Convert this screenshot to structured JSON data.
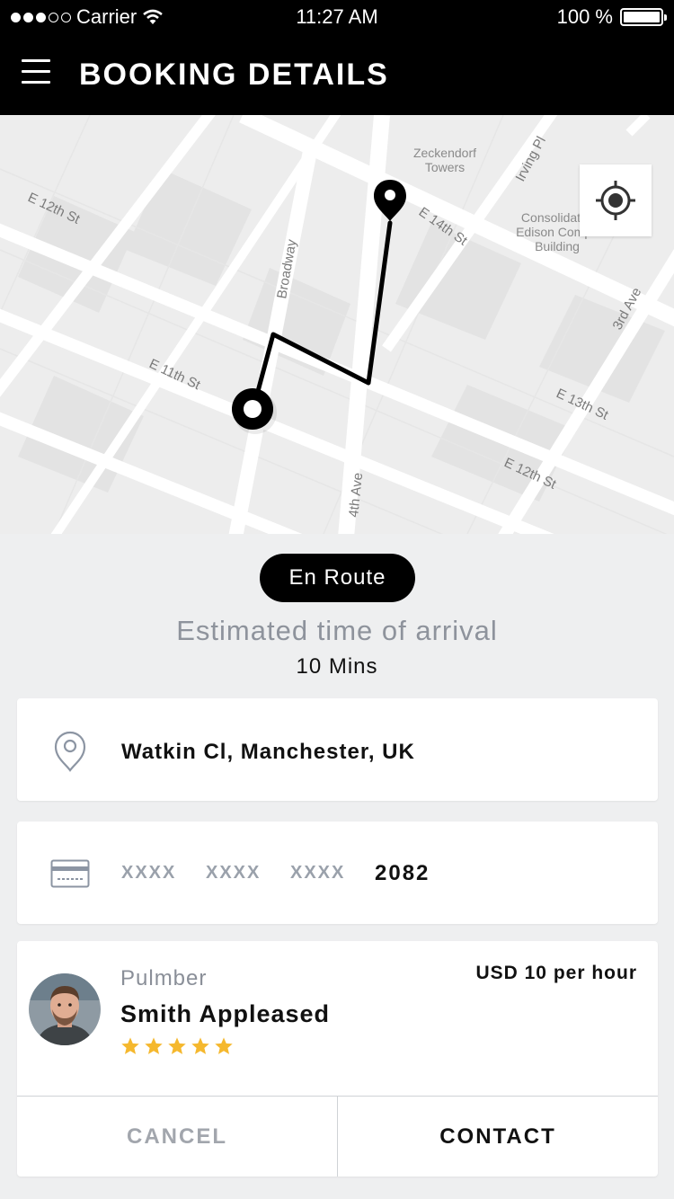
{
  "status_bar": {
    "carrier": "Carrier",
    "time": "11:27 AM",
    "battery": "100 %"
  },
  "header": {
    "title": "BOOKING DETAILS",
    "menu_icon": "hamburger-menu-icon"
  },
  "map": {
    "street_labels": {
      "e12_left": "E 12th St",
      "e14": "E 14th St",
      "irving": "Irving Pl",
      "broadway": "Broadway",
      "e11": "E 11th St",
      "third_ave": "3rd Ave",
      "e13": "E 13th St",
      "fourth_ave": "4th Ave",
      "e12_right": "E 12th St"
    },
    "place_labels": {
      "zeckendorf_1": "Zeckendorf",
      "zeckendorf_2": "Towers",
      "consolidated_1": "Consolidat",
      "consolidated_2": "Edison Compa",
      "consolidated_3": "Building"
    },
    "locate_icon": "crosshair-icon",
    "route_color": "#000000"
  },
  "booking": {
    "status": "En Route",
    "eta_label": "Estimated time of arrival",
    "eta_value": "10 Mins"
  },
  "address": {
    "icon": "location-pin-icon",
    "text": "Watkin Cl, Manchester, UK"
  },
  "payment": {
    "icon": "credit-card-icon",
    "masked_groups": [
      "XXXX",
      "XXXX",
      "XXXX"
    ],
    "last4": "2082"
  },
  "worker": {
    "role": "Pulmber",
    "name": "Smith Appleased",
    "rate": "USD 10 per hour",
    "rating": 5,
    "star_color": "#f5b82e"
  },
  "actions": {
    "cancel_label": "CANCEL",
    "contact_label": "CONTACT"
  }
}
